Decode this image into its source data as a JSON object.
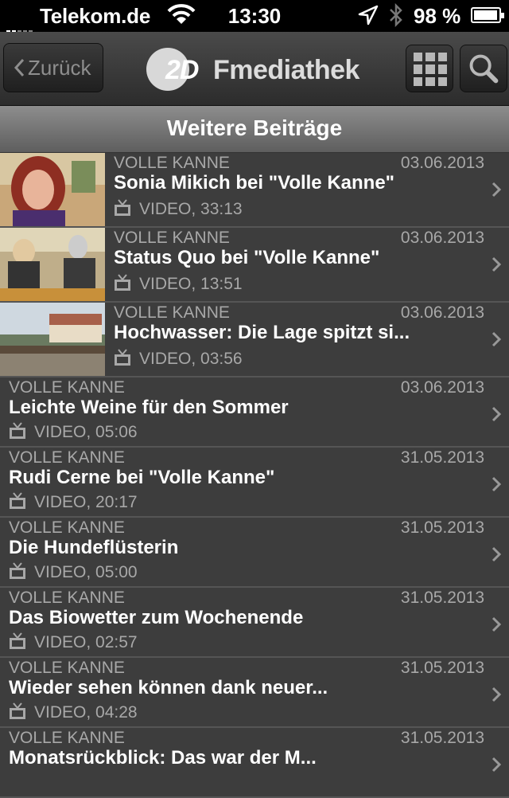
{
  "status_bar": {
    "carrier": "Telekom.de",
    "time": "13:30",
    "battery_text": "98 %",
    "battery_level": 0.98
  },
  "nav": {
    "back_label": "Zurück",
    "logo_prefix": "2D",
    "logo_text": "Fmediathek"
  },
  "section_title": "Weitere Beiträge",
  "items": [
    {
      "category": "VOLLE KANNE",
      "date": "03.06.2013",
      "title": "Sonia Mikich bei \"Volle Kanne\"",
      "meta": "VIDEO, 33:13"
    },
    {
      "category": "VOLLE KANNE",
      "date": "03.06.2013",
      "title": "Status Quo bei \"Volle Kanne\"",
      "meta": "VIDEO, 13:51"
    },
    {
      "category": "VOLLE KANNE",
      "date": "03.06.2013",
      "title": "Hochwasser: Die Lage spitzt si...",
      "meta": "VIDEO, 03:56"
    },
    {
      "category": "VOLLE KANNE",
      "date": "03.06.2013",
      "title": "Leichte Weine für den Sommer",
      "meta": "VIDEO, 05:06"
    },
    {
      "category": "VOLLE KANNE",
      "date": "31.05.2013",
      "title": "Rudi Cerne bei \"Volle Kanne\"",
      "meta": "VIDEO, 20:17"
    },
    {
      "category": "VOLLE KANNE",
      "date": "31.05.2013",
      "title": "Die Hundeflüsterin",
      "meta": "VIDEO, 05:00"
    },
    {
      "category": "VOLLE KANNE",
      "date": "31.05.2013",
      "title": "Das Biowetter zum Wochenende",
      "meta": "VIDEO, 02:57"
    },
    {
      "category": "VOLLE KANNE",
      "date": "31.05.2013",
      "title": "Wieder sehen können dank neuer...",
      "meta": "VIDEO, 04:28"
    },
    {
      "category": "VOLLE KANNE",
      "date": "31.05.2013",
      "title": "Monatsrückblick: Das war der M...",
      "meta": ""
    }
  ]
}
